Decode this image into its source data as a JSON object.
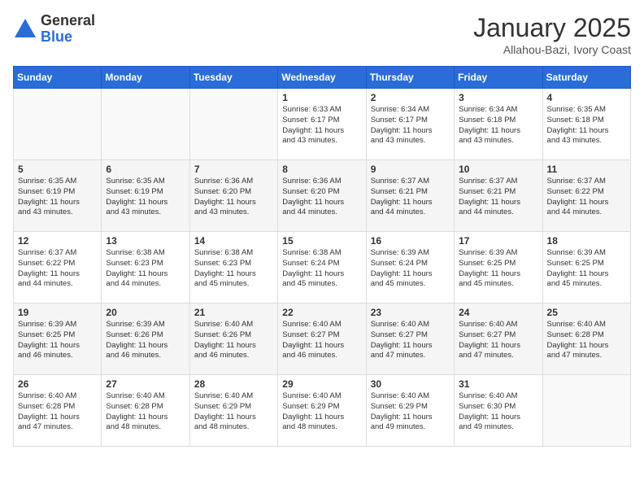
{
  "logo": {
    "general": "General",
    "blue": "Blue"
  },
  "title": "January 2025",
  "location": "Allahou-Bazi, Ivory Coast",
  "weekdays": [
    "Sunday",
    "Monday",
    "Tuesday",
    "Wednesday",
    "Thursday",
    "Friday",
    "Saturday"
  ],
  "weeks": [
    [
      {
        "day": "",
        "info": ""
      },
      {
        "day": "",
        "info": ""
      },
      {
        "day": "",
        "info": ""
      },
      {
        "day": "1",
        "info": "Sunrise: 6:33 AM\nSunset: 6:17 PM\nDaylight: 11 hours\nand 43 minutes."
      },
      {
        "day": "2",
        "info": "Sunrise: 6:34 AM\nSunset: 6:17 PM\nDaylight: 11 hours\nand 43 minutes."
      },
      {
        "day": "3",
        "info": "Sunrise: 6:34 AM\nSunset: 6:18 PM\nDaylight: 11 hours\nand 43 minutes."
      },
      {
        "day": "4",
        "info": "Sunrise: 6:35 AM\nSunset: 6:18 PM\nDaylight: 11 hours\nand 43 minutes."
      }
    ],
    [
      {
        "day": "5",
        "info": "Sunrise: 6:35 AM\nSunset: 6:19 PM\nDaylight: 11 hours\nand 43 minutes."
      },
      {
        "day": "6",
        "info": "Sunrise: 6:35 AM\nSunset: 6:19 PM\nDaylight: 11 hours\nand 43 minutes."
      },
      {
        "day": "7",
        "info": "Sunrise: 6:36 AM\nSunset: 6:20 PM\nDaylight: 11 hours\nand 43 minutes."
      },
      {
        "day": "8",
        "info": "Sunrise: 6:36 AM\nSunset: 6:20 PM\nDaylight: 11 hours\nand 44 minutes."
      },
      {
        "day": "9",
        "info": "Sunrise: 6:37 AM\nSunset: 6:21 PM\nDaylight: 11 hours\nand 44 minutes."
      },
      {
        "day": "10",
        "info": "Sunrise: 6:37 AM\nSunset: 6:21 PM\nDaylight: 11 hours\nand 44 minutes."
      },
      {
        "day": "11",
        "info": "Sunrise: 6:37 AM\nSunset: 6:22 PM\nDaylight: 11 hours\nand 44 minutes."
      }
    ],
    [
      {
        "day": "12",
        "info": "Sunrise: 6:37 AM\nSunset: 6:22 PM\nDaylight: 11 hours\nand 44 minutes."
      },
      {
        "day": "13",
        "info": "Sunrise: 6:38 AM\nSunset: 6:23 PM\nDaylight: 11 hours\nand 44 minutes."
      },
      {
        "day": "14",
        "info": "Sunrise: 6:38 AM\nSunset: 6:23 PM\nDaylight: 11 hours\nand 45 minutes."
      },
      {
        "day": "15",
        "info": "Sunrise: 6:38 AM\nSunset: 6:24 PM\nDaylight: 11 hours\nand 45 minutes."
      },
      {
        "day": "16",
        "info": "Sunrise: 6:39 AM\nSunset: 6:24 PM\nDaylight: 11 hours\nand 45 minutes."
      },
      {
        "day": "17",
        "info": "Sunrise: 6:39 AM\nSunset: 6:25 PM\nDaylight: 11 hours\nand 45 minutes."
      },
      {
        "day": "18",
        "info": "Sunrise: 6:39 AM\nSunset: 6:25 PM\nDaylight: 11 hours\nand 45 minutes."
      }
    ],
    [
      {
        "day": "19",
        "info": "Sunrise: 6:39 AM\nSunset: 6:25 PM\nDaylight: 11 hours\nand 46 minutes."
      },
      {
        "day": "20",
        "info": "Sunrise: 6:39 AM\nSunset: 6:26 PM\nDaylight: 11 hours\nand 46 minutes."
      },
      {
        "day": "21",
        "info": "Sunrise: 6:40 AM\nSunset: 6:26 PM\nDaylight: 11 hours\nand 46 minutes."
      },
      {
        "day": "22",
        "info": "Sunrise: 6:40 AM\nSunset: 6:27 PM\nDaylight: 11 hours\nand 46 minutes."
      },
      {
        "day": "23",
        "info": "Sunrise: 6:40 AM\nSunset: 6:27 PM\nDaylight: 11 hours\nand 47 minutes."
      },
      {
        "day": "24",
        "info": "Sunrise: 6:40 AM\nSunset: 6:27 PM\nDaylight: 11 hours\nand 47 minutes."
      },
      {
        "day": "25",
        "info": "Sunrise: 6:40 AM\nSunset: 6:28 PM\nDaylight: 11 hours\nand 47 minutes."
      }
    ],
    [
      {
        "day": "26",
        "info": "Sunrise: 6:40 AM\nSunset: 6:28 PM\nDaylight: 11 hours\nand 47 minutes."
      },
      {
        "day": "27",
        "info": "Sunrise: 6:40 AM\nSunset: 6:28 PM\nDaylight: 11 hours\nand 48 minutes."
      },
      {
        "day": "28",
        "info": "Sunrise: 6:40 AM\nSunset: 6:29 PM\nDaylight: 11 hours\nand 48 minutes."
      },
      {
        "day": "29",
        "info": "Sunrise: 6:40 AM\nSunset: 6:29 PM\nDaylight: 11 hours\nand 48 minutes."
      },
      {
        "day": "30",
        "info": "Sunrise: 6:40 AM\nSunset: 6:29 PM\nDaylight: 11 hours\nand 49 minutes."
      },
      {
        "day": "31",
        "info": "Sunrise: 6:40 AM\nSunset: 6:30 PM\nDaylight: 11 hours\nand 49 minutes."
      },
      {
        "day": "",
        "info": ""
      }
    ]
  ]
}
